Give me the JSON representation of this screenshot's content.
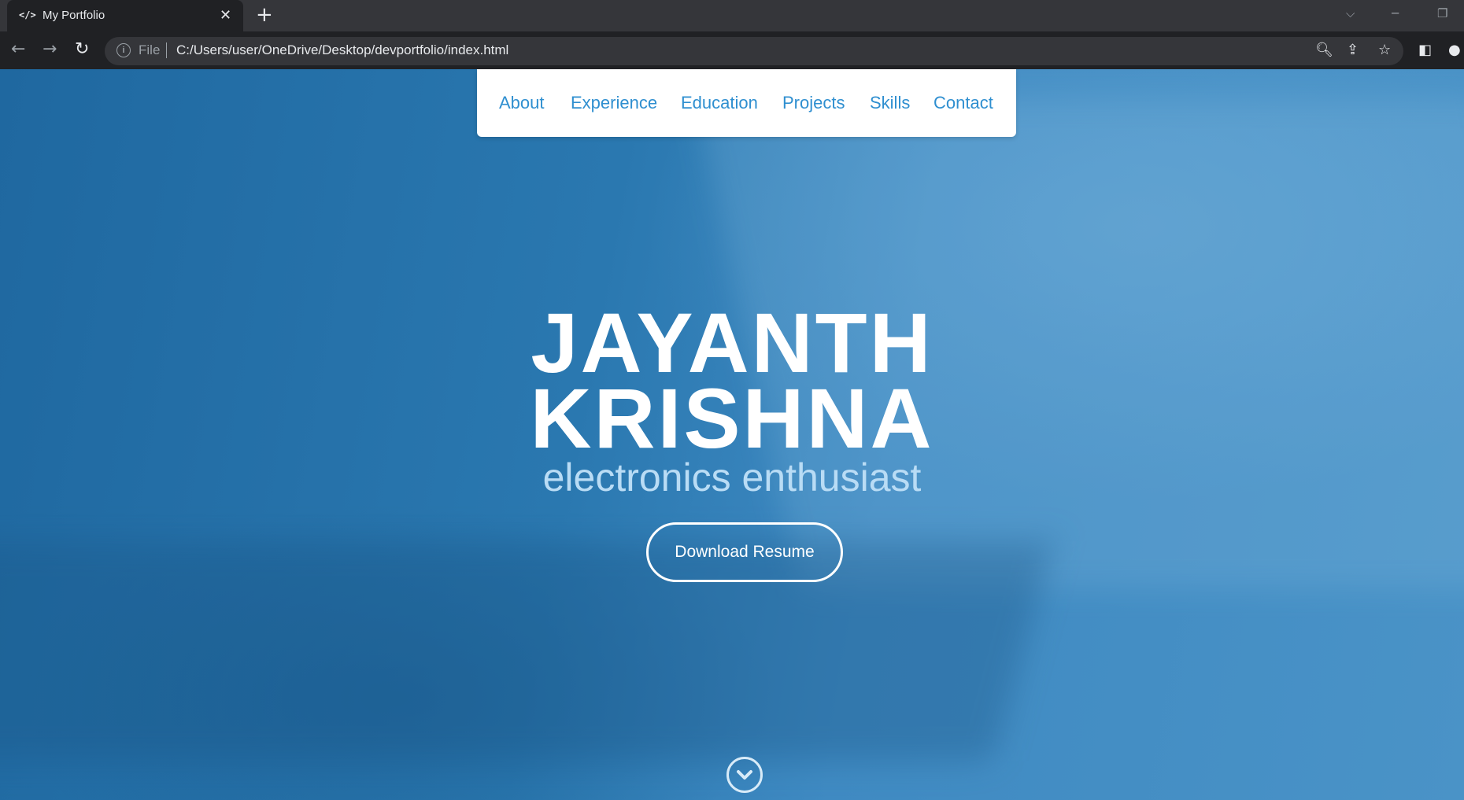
{
  "browser": {
    "tab_title": "My Portfolio",
    "tab_favicon": "</>",
    "close_glyph": "✕",
    "new_tab_glyph": "+",
    "address_label": "File",
    "url": "C:/Users/user/OneDrive/Desktop/devportfolio/index.html",
    "icons": [
      "back-icon",
      "forward-icon",
      "reload-icon",
      "info-icon",
      "zoom-icon",
      "share-icon",
      "star-icon",
      "sidepanel-icon",
      "profile-icon"
    ]
  },
  "nav": {
    "items": [
      "About",
      "Experience",
      "Education",
      "Projects",
      "Skills",
      "Contact"
    ],
    "link_color": "#2f8fd0"
  },
  "hero": {
    "first_name": "JAYANTH",
    "last_name": "KRISHNA",
    "tagline": "electronics enthusiast",
    "button_label": "Download Resume",
    "tagline_color": "#b9dcf5"
  },
  "colors": {
    "chrome_bg": "#35363a",
    "toolbar_bg": "#202124",
    "hero_blue": "#2a78b0"
  }
}
